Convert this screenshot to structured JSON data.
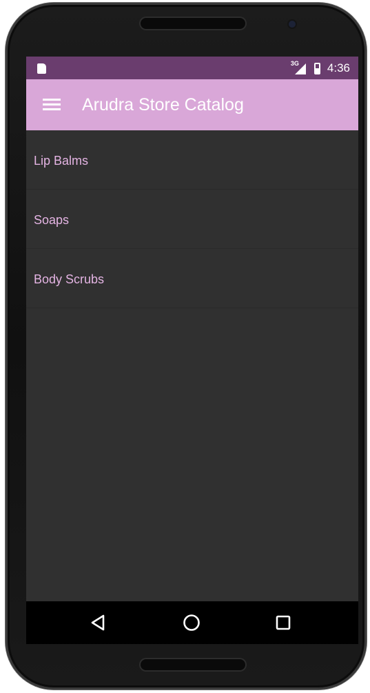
{
  "status_bar": {
    "network_label": "3G",
    "time": "4:36",
    "icons": [
      "sd-card-icon",
      "cellular-signal-icon",
      "battery-icon"
    ]
  },
  "toolbar": {
    "title": "Arudra Store Catalog",
    "menu_icon": "hamburger-menu-icon"
  },
  "categories": [
    {
      "label": "Lip Balms"
    },
    {
      "label": "Soaps"
    },
    {
      "label": "Body Scrubs"
    }
  ],
  "nav_bar": {
    "icons": [
      "back-icon",
      "home-icon",
      "recents-icon"
    ]
  },
  "colors": {
    "status_bar": "#6a3d6e",
    "toolbar": "#d9a7d8",
    "list_text": "#e4b4e3",
    "screen_background": "#303030"
  }
}
